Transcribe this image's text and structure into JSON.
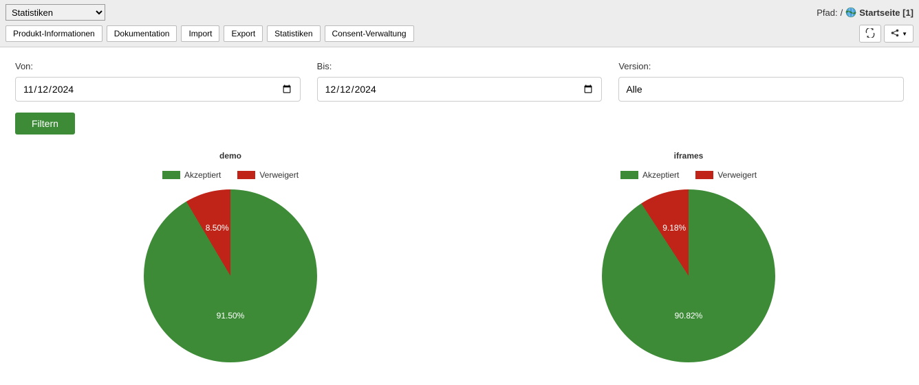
{
  "breadcrumb": {
    "prefix": "Pfad:",
    "sep": "/",
    "page": "Startseite [1]"
  },
  "page_select": {
    "value": "Statistiken"
  },
  "tabs": {
    "items": [
      "Produkt-Informationen",
      "Dokumentation",
      "Import",
      "Export",
      "Statistiken",
      "Consent-Verwaltung"
    ]
  },
  "filters": {
    "von": {
      "label": "Von:",
      "value": "2024-11-12",
      "display": "12.11.2024"
    },
    "bis": {
      "label": "Bis:",
      "value": "2024-12-12",
      "display": "12.12.2024"
    },
    "version": {
      "label": "Version:",
      "value": "Alle"
    },
    "submit": "Filtern"
  },
  "legend": {
    "accepted": "Akzeptiert",
    "rejected": "Verweigert"
  },
  "colors": {
    "accepted": "#3d8b37",
    "rejected": "#c02418"
  },
  "chart_data": [
    {
      "type": "pie",
      "title": "demo",
      "series": [
        {
          "name": "Akzeptiert",
          "value": 91.5,
          "label": "91.50%",
          "color": "#3d8b37"
        },
        {
          "name": "Verweigert",
          "value": 8.5,
          "label": "8.50%",
          "color": "#c02418"
        }
      ]
    },
    {
      "type": "pie",
      "title": "iframes",
      "series": [
        {
          "name": "Akzeptiert",
          "value": 90.82,
          "label": "90.82%",
          "color": "#3d8b37"
        },
        {
          "name": "Verweigert",
          "value": 9.18,
          "label": "9.18%",
          "color": "#c02418"
        }
      ]
    }
  ]
}
